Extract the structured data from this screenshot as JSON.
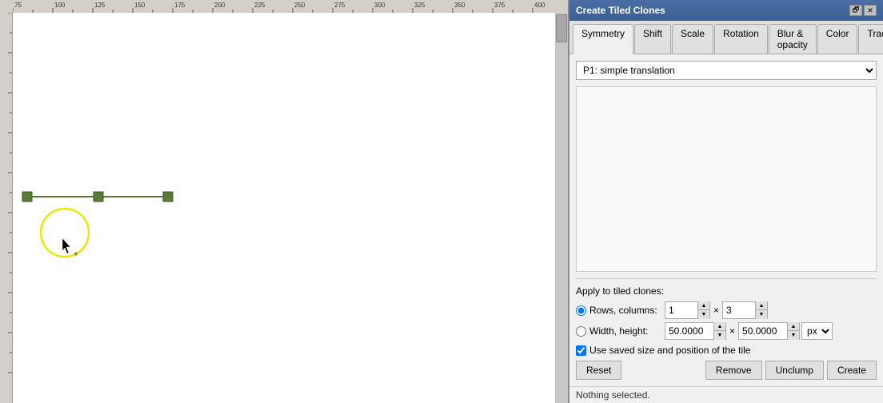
{
  "canvas": {
    "background": "#f5f5f5"
  },
  "dialog": {
    "title": "Create Tiled Clones",
    "title_btn_restore": "🗗",
    "title_btn_close": "✕",
    "tabs": [
      {
        "label": "Symmetry",
        "active": true
      },
      {
        "label": "Shift"
      },
      {
        "label": "Scale"
      },
      {
        "label": "Rotation"
      },
      {
        "label": "Blur & opacity"
      },
      {
        "label": "Color"
      },
      {
        "label": "Trace"
      }
    ],
    "dropdown_value": "P1: simple translation",
    "apply_label": "Apply to tiled clones:",
    "rows_cols_label": "Rows, columns:",
    "rows_value": "1",
    "cols_value": "3",
    "width_height_label": "Width, height:",
    "width_value": "50.0000",
    "height_value": "50.0000",
    "unit": "px",
    "checkbox_label": "Use saved size and position of the tile",
    "checkbox_checked": true,
    "btn_reset": "Reset",
    "btn_remove": "Remove",
    "btn_unclump": "Unclump",
    "btn_create": "Create",
    "status": "Nothing selected."
  }
}
